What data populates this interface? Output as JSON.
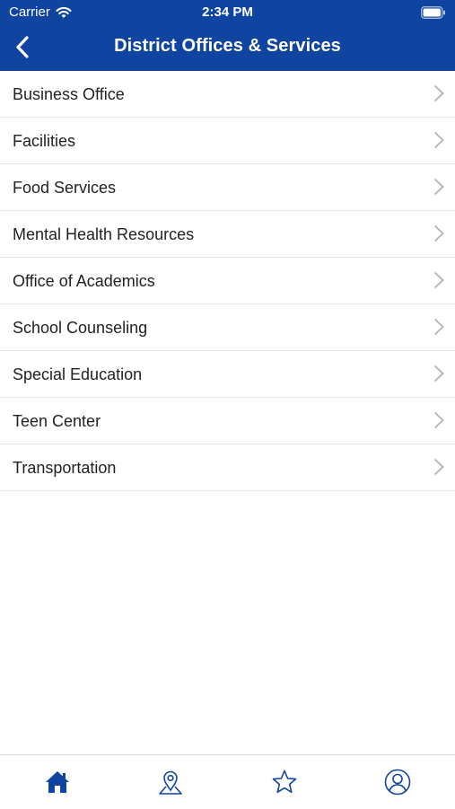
{
  "status_bar": {
    "carrier": "Carrier",
    "time": "2:34 PM"
  },
  "nav": {
    "title": "District Offices & Services",
    "back_icon": "chevron-left-icon"
  },
  "list": {
    "items": [
      {
        "label": "Business Office"
      },
      {
        "label": "Facilities"
      },
      {
        "label": "Food Services"
      },
      {
        "label": "Mental Health Resources"
      },
      {
        "label": "Office of Academics"
      },
      {
        "label": "School Counseling"
      },
      {
        "label": "Special Education"
      },
      {
        "label": "Teen Center"
      },
      {
        "label": "Transportation"
      }
    ]
  },
  "tab_bar": {
    "tabs": [
      {
        "icon": "home-icon",
        "selected": true
      },
      {
        "icon": "map-pin-icon",
        "selected": false
      },
      {
        "icon": "star-icon",
        "selected": false
      },
      {
        "icon": "user-icon",
        "selected": false
      }
    ]
  },
  "colors": {
    "brand": "#0f44a0",
    "divider": "#e6e6e6",
    "chevron": "#b3b3b3",
    "text": "#222222"
  }
}
